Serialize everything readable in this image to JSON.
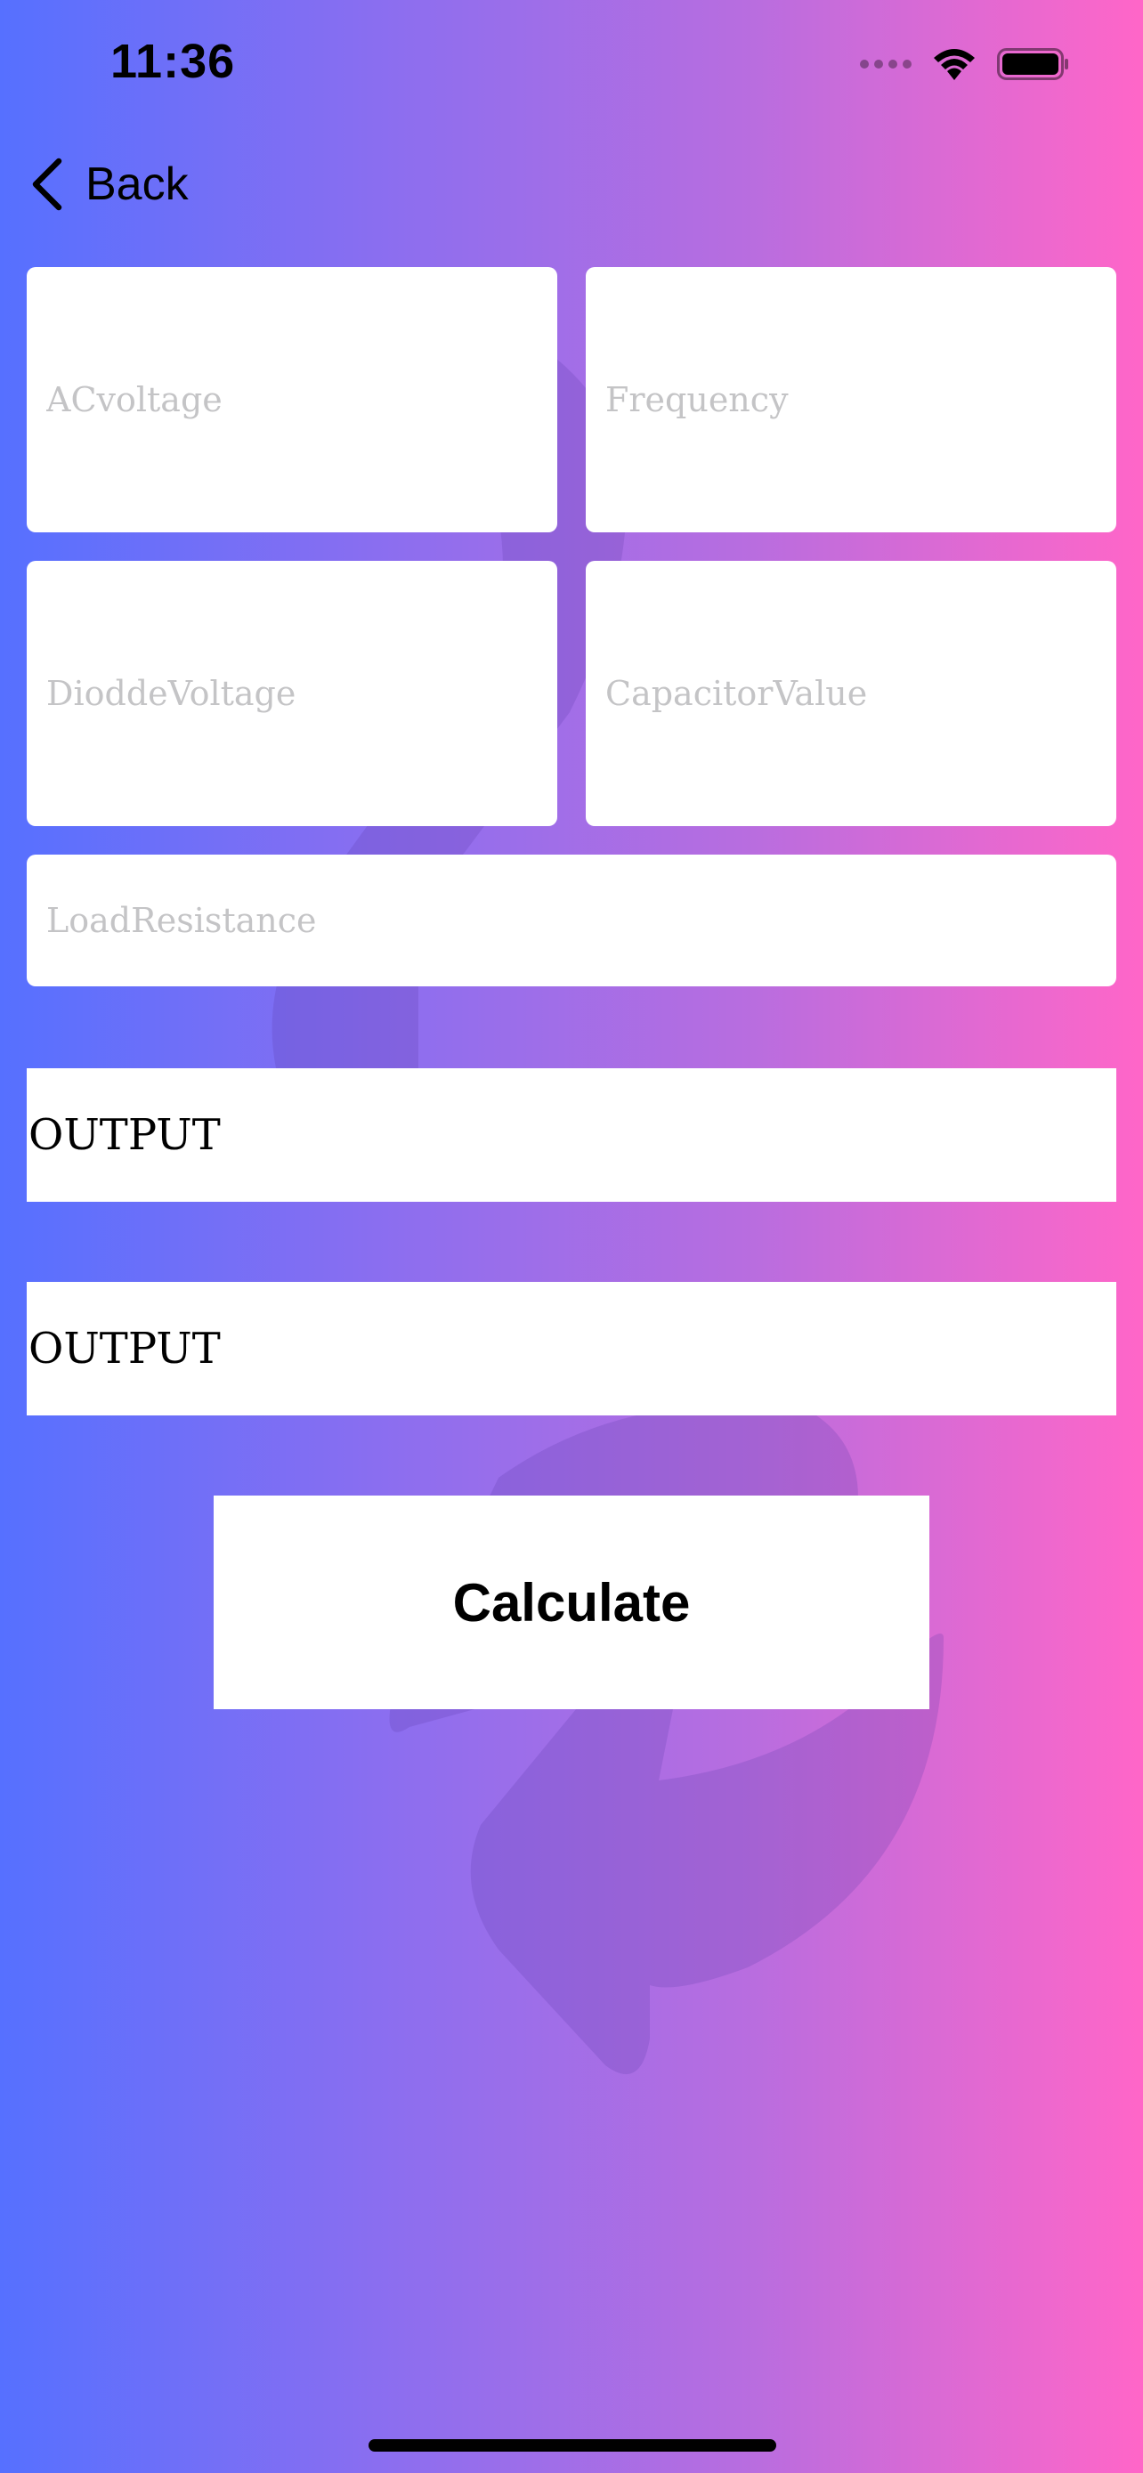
{
  "status_bar": {
    "time": "11:36",
    "signal_icon": "cellular-signal-icon",
    "wifi_icon": "wifi-icon",
    "battery_icon": "battery-icon"
  },
  "nav": {
    "back_label": "Back",
    "back_icon": "chevron-left-icon"
  },
  "form": {
    "ac_voltage_placeholder": "ACvoltage",
    "frequency_placeholder": "Frequency",
    "diode_voltage_placeholder": "DioddeVoltage",
    "capacitor_value_placeholder": "CapacitorValue",
    "load_resistance_placeholder": "LoadResistance"
  },
  "outputs": {
    "output_1": "OUTPUT",
    "output_2": "OUTPUT"
  },
  "actions": {
    "calculate_label": "Calculate"
  },
  "colors": {
    "gradient_start": "#5670ff",
    "gradient_end": "#ff66c8",
    "field_background": "#ffffff",
    "placeholder": "#c4c4c6"
  }
}
